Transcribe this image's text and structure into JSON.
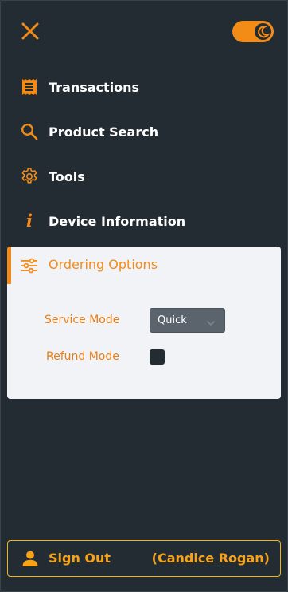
{
  "nav": {
    "items": [
      {
        "label": "Transactions",
        "icon": "receipt-icon"
      },
      {
        "label": "Product Search",
        "icon": "search-icon"
      },
      {
        "label": "Tools",
        "icon": "gear-icon"
      },
      {
        "label": "Device Information",
        "icon": "info-icon"
      }
    ]
  },
  "ordering": {
    "label": "Ordering Options",
    "icon": "sliders-icon",
    "service_mode_label": "Service Mode",
    "service_mode_value": "Quick",
    "refund_mode_label": "Refund Mode",
    "refund_mode_checked": false
  },
  "info_glyph": "i",
  "signout": {
    "label": "Sign Out",
    "user": "(Candice Rogan)"
  },
  "theme": {
    "dark_mode": true
  },
  "colors": {
    "accent": "#f38b17",
    "background": "#232b33",
    "panel": "#f1f3f7",
    "signout": "#f7a31a"
  }
}
